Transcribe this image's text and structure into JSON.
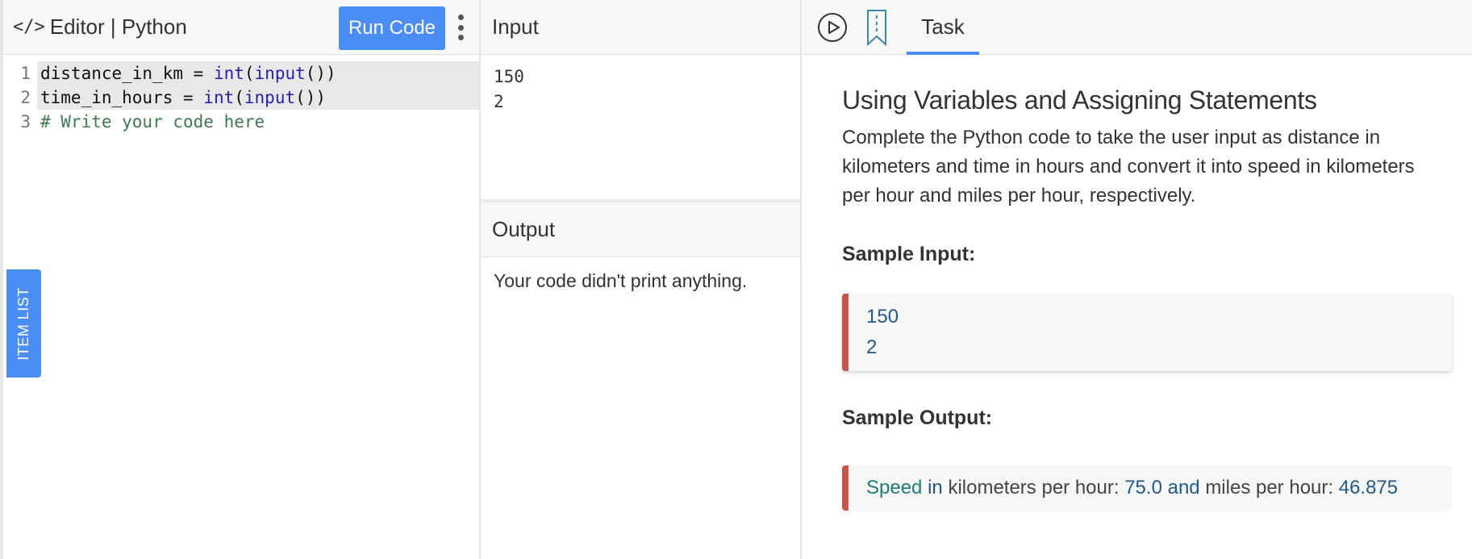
{
  "editor": {
    "title": "Editor | Python",
    "run_label": "Run Code",
    "lines": [
      {
        "num": "1",
        "parts": [
          [
            "distance_in_km = ",
            ""
          ],
          [
            "int",
            "kw"
          ],
          [
            "(",
            ""
          ],
          [
            "input",
            "kw"
          ],
          [
            "())",
            ""
          ]
        ]
      },
      {
        "num": "2",
        "parts": [
          [
            "time_in_hours = ",
            ""
          ],
          [
            "int",
            "kw"
          ],
          [
            "(",
            ""
          ],
          [
            "input",
            "kw"
          ],
          [
            "())",
            ""
          ]
        ]
      },
      {
        "num": "3",
        "parts": [
          [
            "# Write your code here",
            "cm"
          ]
        ]
      }
    ],
    "item_list_label": "ITEM LIST"
  },
  "input": {
    "title": "Input",
    "value": "150\n2"
  },
  "output": {
    "title": "Output",
    "value": "Your code didn't print anything."
  },
  "task": {
    "tab_label": "Task",
    "title": "Using Variables and Assigning Statements",
    "description": "Complete the Python code to take the user input as distance in kilometers and time in hours and convert it into speed in kilometers per hour and miles per hour, respectively.",
    "sample_input_heading": "Sample Input:",
    "sample_input_value": "150\n2",
    "sample_output_heading": "Sample Output:",
    "sample_output": {
      "w1": "Speed",
      "w2": "in",
      "w3": "kilometers per hour:",
      "w4": "75.0",
      "w5": "and",
      "w6": "miles per hour:",
      "w7": "46.875"
    }
  },
  "colors": {
    "accent": "#4a8df5",
    "sample_border": "#c9534c"
  }
}
